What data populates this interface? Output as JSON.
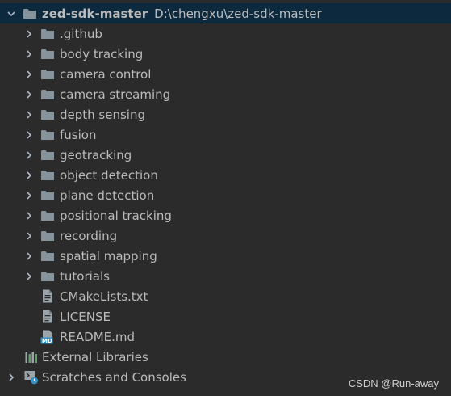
{
  "root": {
    "name": "zed-sdk-master",
    "path": "D:\\chengxu\\zed-sdk-master",
    "icon": "folder-icon",
    "expanded": true
  },
  "folders": [
    {
      "label": ".github",
      "icon": "folder-icon"
    },
    {
      "label": "body tracking",
      "icon": "folder-icon"
    },
    {
      "label": "camera control",
      "icon": "folder-icon"
    },
    {
      "label": "camera streaming",
      "icon": "folder-icon"
    },
    {
      "label": "depth sensing",
      "icon": "folder-icon"
    },
    {
      "label": "fusion",
      "icon": "folder-icon"
    },
    {
      "label": "geotracking",
      "icon": "folder-icon"
    },
    {
      "label": "object detection",
      "icon": "folder-icon"
    },
    {
      "label": "plane detection",
      "icon": "folder-icon"
    },
    {
      "label": "positional tracking",
      "icon": "folder-icon"
    },
    {
      "label": "recording",
      "icon": "folder-icon"
    },
    {
      "label": "spatial mapping",
      "icon": "folder-icon"
    },
    {
      "label": "tutorials",
      "icon": "folder-icon"
    }
  ],
  "files": [
    {
      "label": "CMakeLists.txt",
      "icon": "text-file-icon"
    },
    {
      "label": "LICENSE",
      "icon": "text-file-icon"
    },
    {
      "label": "README.md",
      "icon": "markdown-file-icon",
      "badge": "MD"
    }
  ],
  "external_libraries": {
    "label": "External Libraries",
    "icon": "library-icon"
  },
  "scratches": {
    "label": "Scratches and Consoles",
    "icon": "scratches-icon"
  },
  "watermark": "CSDN @Run-away",
  "colors": {
    "background": "#2b2b2b",
    "selection": "#0d293e",
    "text": "#bbbbbb",
    "folder": "#87939a",
    "library": "#5e9f6a",
    "scratch": "#3592c4"
  }
}
